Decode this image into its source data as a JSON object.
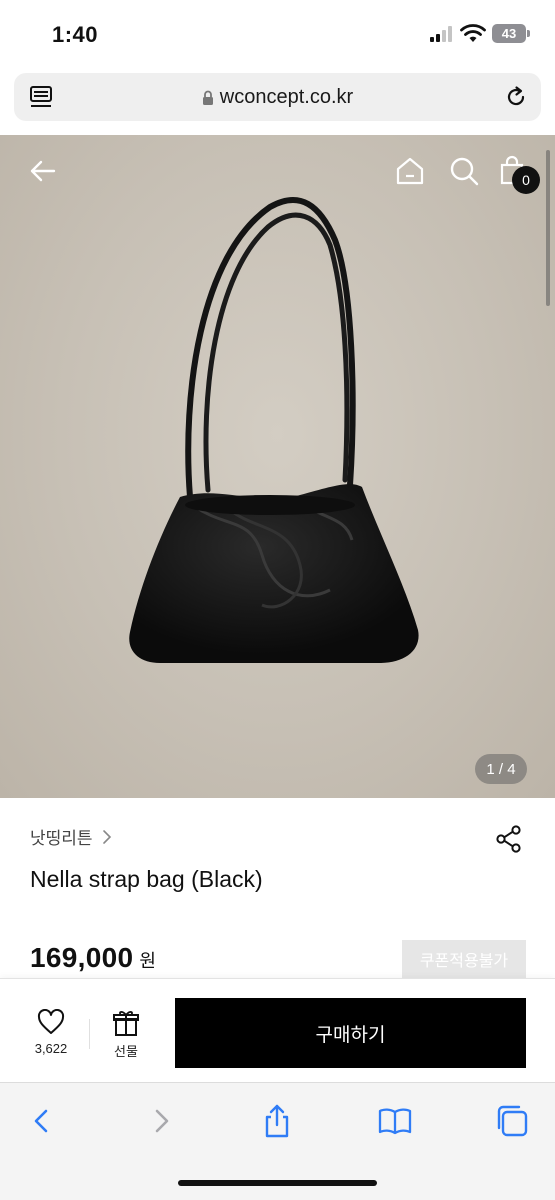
{
  "status": {
    "time": "1:40",
    "battery": "43"
  },
  "browser": {
    "url": "wconcept.co.kr"
  },
  "hero": {
    "image_counter": "1 / 4",
    "cart_count": "0"
  },
  "product": {
    "brand": "낫띵리튼",
    "name": "Nella strap bag (Black)",
    "price": "169,000",
    "currency": "원",
    "coupon_badge": "쿠폰적용불가"
  },
  "purchase_bar": {
    "like_count": "3,622",
    "gift_label": "선물",
    "buy_label": "구매하기"
  },
  "colors": {
    "accent": "#000000",
    "hero_bg": "#c7c0b5",
    "safari_blue": "#2f7cf6"
  },
  "icons": [
    "back-arrow-icon",
    "home-icon",
    "search-icon",
    "shopping-bag-icon",
    "share-icon",
    "heart-icon",
    "gift-icon",
    "chevron-left-icon",
    "chevron-right-icon",
    "safari-share-icon",
    "book-icon",
    "tabs-icon"
  ]
}
